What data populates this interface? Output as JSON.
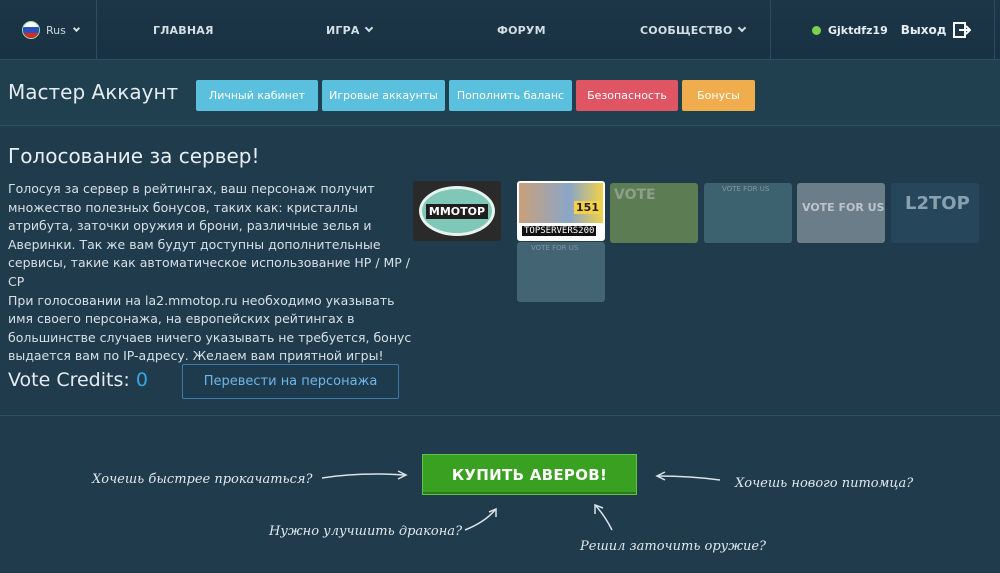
{
  "nav": {
    "lang": "Rus",
    "items": [
      {
        "label": "ГЛАВНАЯ"
      },
      {
        "label": "ИГРА"
      },
      {
        "label": "ФОРУМ"
      },
      {
        "label": "СООБЩЕСТВО"
      }
    ],
    "username": "Gjktdfz19",
    "logout": "Выход"
  },
  "account": {
    "title": "Мастер Аккаунт",
    "tabs": [
      {
        "label": "Личный кабинет",
        "color": "#5bc0de"
      },
      {
        "label": "Игровые аккаунты",
        "color": "#5bc0de"
      },
      {
        "label": "Пополнить баланс",
        "color": "#5bc0de"
      },
      {
        "label": "Безопасность",
        "color": "#e05563"
      },
      {
        "label": "Бонусы",
        "color": "#f0ad4e"
      }
    ]
  },
  "vote": {
    "title": "Голосование за сервер!",
    "para1": "Голосуя за сервер в рейтингах, ваш персонаж получит множество полезных бонусов, таких как: кристаллы атрибута, заточки оружия и брони, различные зелья и Аверинки. Так же вам будут доступны дополнительные сервисы, такие как автоматическое использование HP / MP / CP",
    "para2": "При голосовании на la2.mmotop.ru необходимо указывать имя своего персонажа, на европейских рейтингах в большинстве случаев ничего указывать не требуется, бонус выдается вам по IP-адресу. Желаем вам приятной игры!",
    "banners": [
      {
        "name": "mmotop-banner",
        "text": "MMOTOP"
      },
      {
        "name": "topservers200-banner",
        "text": "TOPSERVERS200",
        "badge": "151"
      },
      {
        "name": "l2hopzone-banner",
        "text": "VOTE"
      },
      {
        "name": "vote-for-us-banner",
        "text": "VOTE FOR US"
      },
      {
        "name": "l2network-banner",
        "text": "VOTE FOR US"
      },
      {
        "name": "l2top-banner",
        "text": "L2TOP"
      },
      {
        "name": "l2topzone-banner",
        "text": "VOTE FOR US"
      }
    ],
    "credits_label": "Vote Credits:",
    "credits_value": "0",
    "transfer_button": "Перевести на персонажа"
  },
  "promo": {
    "buy_button": "КУПИТЬ АВЕРОВ!",
    "hint_left": "Хочешь быстрее прокачаться?",
    "hint_right": "Хочешь нового питомца?",
    "hint_bottom_left": "Нужно улучшить дракона?",
    "hint_bottom_right": "Решил заточить оружие?"
  },
  "colors": {
    "background": "#1f3b4c",
    "accent_blue": "#39a6e6",
    "buy_green": "#3aa021",
    "online_dot": "#7bd14f"
  }
}
